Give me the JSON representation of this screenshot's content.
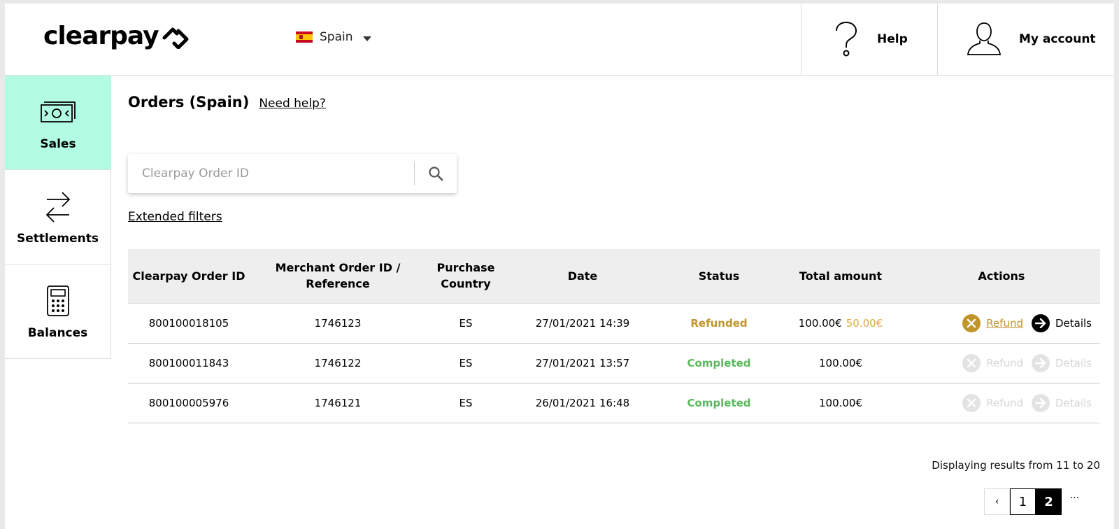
{
  "header": {
    "brand": "clearpay",
    "country": "Spain",
    "help_label": "Help",
    "account_label": "My account"
  },
  "sidebar": {
    "items": [
      {
        "label": "Sales",
        "icon": "banknote-icon",
        "active": true
      },
      {
        "label": "Settlements",
        "icon": "swap-arrows-icon",
        "active": false
      },
      {
        "label": "Balances",
        "icon": "calculator-icon",
        "active": false
      }
    ]
  },
  "main": {
    "title": "Orders (Spain)",
    "need_help": "Need help?",
    "search_placeholder": "Clearpay Order ID",
    "extended_filters": "Extended filters"
  },
  "table": {
    "headers": {
      "order_id": "Clearpay Order ID",
      "merchant_ref_1": "Merchant Order ID /",
      "merchant_ref_2": "Reference",
      "country_1": "Purchase",
      "country_2": "Country",
      "date": "Date",
      "status": "Status",
      "total": "Total amount",
      "actions": "Actions"
    },
    "rows": [
      {
        "order_id": "800100018105",
        "ref": "1746123",
        "country": "ES",
        "date": "27/01/2021 14:39",
        "status": "Refunded",
        "amount": "100.00€",
        "amount_refunded": "50.00€",
        "refund": "Refund",
        "details": "Details"
      },
      {
        "order_id": "800100011843",
        "ref": "1746122",
        "country": "ES",
        "date": "27/01/2021 13:57",
        "status": "Completed",
        "amount": "100.00€",
        "refund": "Refund",
        "details": "Details"
      },
      {
        "order_id": "800100005976",
        "ref": "1746121",
        "country": "ES",
        "date": "26/01/2021 16:48",
        "status": "Completed",
        "amount": "100.00€",
        "refund": "Refund",
        "details": "Details"
      }
    ]
  },
  "footer": {
    "results_text": "Displaying results from 11 to 20",
    "pager": {
      "prev": "‹",
      "page1": "1",
      "page2": "2",
      "more": "..."
    }
  },
  "colors": {
    "accent": "#b2fce4",
    "refunded": "#c2952b",
    "completed": "#5cb85c"
  }
}
